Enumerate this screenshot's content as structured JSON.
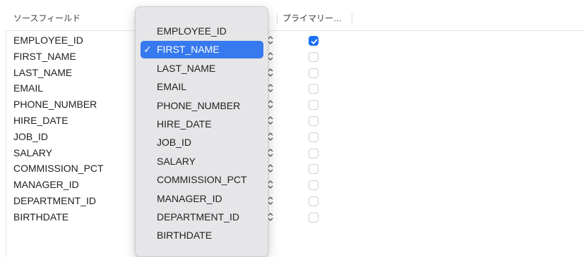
{
  "header": {
    "source_field": "ソースフィールド",
    "primary": "プライマリー…"
  },
  "rows": [
    {
      "field": "EMPLOYEE_ID",
      "primary": true
    },
    {
      "field": "FIRST_NAME",
      "primary": false
    },
    {
      "field": "LAST_NAME",
      "primary": false
    },
    {
      "field": "EMAIL",
      "primary": false
    },
    {
      "field": "PHONE_NUMBER",
      "primary": false
    },
    {
      "field": "HIRE_DATE",
      "primary": false
    },
    {
      "field": "JOB_ID",
      "primary": false
    },
    {
      "field": "SALARY",
      "primary": false
    },
    {
      "field": "COMMISSION_PCT",
      "primary": false
    },
    {
      "field": "MANAGER_ID",
      "primary": false
    },
    {
      "field": "DEPARTMENT_ID",
      "primary": false
    },
    {
      "field": "BIRTHDATE",
      "primary": false
    }
  ],
  "popup_menu": {
    "selected": "FIRST_NAME",
    "check_glyph": "✓",
    "items": [
      "EMPLOYEE_ID",
      "FIRST_NAME",
      "LAST_NAME",
      "EMAIL",
      "PHONE_NUMBER",
      "HIRE_DATE",
      "JOB_ID",
      "SALARY",
      "COMMISSION_PCT",
      "MANAGER_ID",
      "DEPARTMENT_ID",
      "BIRTHDATE"
    ]
  },
  "icons": {
    "stepper": "up-down-chevron-icon",
    "checkbox": "checkmark-icon"
  },
  "colors": {
    "accent": "#3779ee",
    "checkbox_checked": "#1a6ff5"
  }
}
